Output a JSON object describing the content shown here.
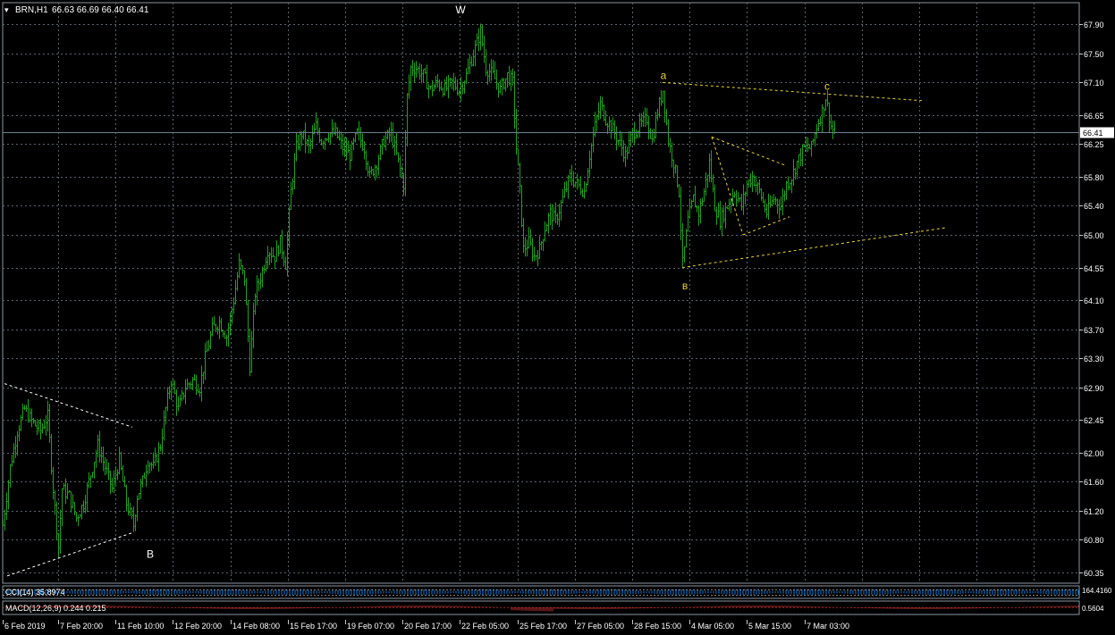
{
  "header": {
    "symbol_text": "BRN,H1",
    "ohlc_text": "66.63 66.69 66.40 66.41"
  },
  "colors": {
    "background": "#000000",
    "grid": "#5a6470",
    "candles": "#22a022",
    "wave_labels_primary": "#ffffff",
    "wave_labels_secondary": "#e6d33a",
    "triangle_lines": "#ffffff",
    "channel_lines": "#e6d33a",
    "current_price_line": "#6f7f8f",
    "indicator_cci": "#1e90ff",
    "indicator_macd": "#ff4040",
    "indicator_signal": "#ff4040"
  },
  "chart_data": {
    "type": "candlestick",
    "title": "BRN,H1",
    "current_price": 66.41,
    "current_price_label": "66.41",
    "ylim": [
      60.2,
      68.2
    ],
    "y_ticks": [
      "67.90",
      "67.50",
      "67.10",
      "66.65",
      "66.25",
      "65.80",
      "65.40",
      "65.00",
      "64.55",
      "64.10",
      "63.70",
      "63.30",
      "62.90",
      "62.45",
      "62.00",
      "61.60",
      "61.20",
      "60.80",
      "60.35"
    ],
    "x_ticks": [
      "6 Feb 2019",
      "7 Feb 20:00",
      "11 Feb 10:00",
      "12 Feb 20:00",
      "14 Feb 08:00",
      "15 Feb 17:00",
      "19 Feb 07:00",
      "20 Feb 17:00",
      "22 Feb 05:00",
      "25 Feb 17:00",
      "27 Feb 05:00",
      "28 Feb 15:00",
      "4 Mar 05:00",
      "5 Mar 15:00",
      "7 Mar 03:00"
    ],
    "price_path": [
      [
        0,
        61.0
      ],
      [
        8,
        61.8
      ],
      [
        16,
        62.3
      ],
      [
        24,
        62.6
      ],
      [
        34,
        62.4
      ],
      [
        42,
        62.3
      ],
      [
        50,
        62.5
      ],
      [
        56,
        61.5
      ],
      [
        62,
        60.7
      ],
      [
        66,
        61.5
      ],
      [
        74,
        61.4
      ],
      [
        82,
        61.1
      ],
      [
        90,
        61.3
      ],
      [
        98,
        61.7
      ],
      [
        106,
        62.1
      ],
      [
        114,
        61.8
      ],
      [
        122,
        61.5
      ],
      [
        130,
        61.9
      ],
      [
        138,
        61.3
      ],
      [
        146,
        61.0
      ],
      [
        150,
        61.4
      ],
      [
        156,
        61.6
      ],
      [
        162,
        61.9
      ],
      [
        168,
        61.8
      ],
      [
        176,
        62.1
      ],
      [
        182,
        62.6
      ],
      [
        188,
        63.0
      ],
      [
        196,
        62.6
      ],
      [
        204,
        62.9
      ],
      [
        212,
        63.0
      ],
      [
        220,
        62.9
      ],
      [
        226,
        63.3
      ],
      [
        234,
        63.7
      ],
      [
        242,
        63.8
      ],
      [
        250,
        63.6
      ],
      [
        258,
        64.1
      ],
      [
        264,
        64.6
      ],
      [
        270,
        64.4
      ],
      [
        276,
        63.2
      ],
      [
        282,
        64.2
      ],
      [
        290,
        64.5
      ],
      [
        296,
        64.8
      ],
      [
        304,
        64.7
      ],
      [
        310,
        64.9
      ],
      [
        316,
        64.6
      ],
      [
        322,
        65.6
      ],
      [
        328,
        66.2
      ],
      [
        334,
        66.4
      ],
      [
        342,
        66.2
      ],
      [
        350,
        66.5
      ],
      [
        356,
        66.3
      ],
      [
        364,
        66.4
      ],
      [
        372,
        66.4
      ],
      [
        380,
        66.2
      ],
      [
        388,
        66.1
      ],
      [
        396,
        66.4
      ],
      [
        404,
        66.2
      ],
      [
        410,
        65.8
      ],
      [
        418,
        66.0
      ],
      [
        426,
        66.3
      ],
      [
        434,
        66.4
      ],
      [
        440,
        66.1
      ],
      [
        448,
        65.7
      ],
      [
        452,
        66.9
      ],
      [
        456,
        67.3
      ],
      [
        462,
        67.3
      ],
      [
        470,
        67.2
      ],
      [
        478,
        67.0
      ],
      [
        486,
        67.1
      ],
      [
        494,
        67.0
      ],
      [
        502,
        67.1
      ],
      [
        510,
        67.0
      ],
      [
        518,
        67.2
      ],
      [
        526,
        67.5
      ],
      [
        534,
        67.8
      ],
      [
        540,
        67.3
      ],
      [
        548,
        67.2
      ],
      [
        556,
        67.0
      ],
      [
        564,
        67.2
      ],
      [
        570,
        67.1
      ],
      [
        574,
        66.2
      ],
      [
        578,
        65.6
      ],
      [
        582,
        64.8
      ],
      [
        588,
        64.9
      ],
      [
        594,
        64.7
      ],
      [
        600,
        64.8
      ],
      [
        606,
        65.1
      ],
      [
        612,
        65.3
      ],
      [
        618,
        65.2
      ],
      [
        626,
        65.5
      ],
      [
        634,
        65.8
      ],
      [
        642,
        65.7
      ],
      [
        650,
        65.6
      ],
      [
        656,
        66.1
      ],
      [
        662,
        66.5
      ],
      [
        668,
        66.8
      ],
      [
        674,
        66.6
      ],
      [
        680,
        66.5
      ],
      [
        688,
        66.3
      ],
      [
        696,
        66.1
      ],
      [
        704,
        66.4
      ],
      [
        712,
        66.5
      ],
      [
        720,
        66.6
      ],
      [
        726,
        66.3
      ],
      [
        732,
        66.7
      ],
      [
        738,
        67.0
      ],
      [
        744,
        66.3
      ],
      [
        750,
        66.0
      ],
      [
        756,
        65.6
      ],
      [
        760,
        64.6
      ],
      [
        766,
        65.2
      ],
      [
        772,
        65.5
      ],
      [
        778,
        65.3
      ],
      [
        784,
        65.6
      ],
      [
        790,
        66.0
      ],
      [
        796,
        65.4
      ],
      [
        802,
        65.2
      ],
      [
        810,
        65.4
      ],
      [
        818,
        65.6
      ],
      [
        826,
        65.4
      ],
      [
        832,
        65.7
      ],
      [
        838,
        65.8
      ],
      [
        846,
        65.6
      ],
      [
        854,
        65.3
      ],
      [
        862,
        65.5
      ],
      [
        870,
        65.4
      ],
      [
        876,
        65.7
      ],
      [
        882,
        65.8
      ],
      [
        888,
        66.0
      ],
      [
        896,
        66.2
      ],
      [
        904,
        66.2
      ],
      [
        910,
        66.5
      ],
      [
        916,
        66.7
      ],
      [
        920,
        66.9
      ],
      [
        926,
        66.5
      ],
      [
        930,
        66.41
      ]
    ],
    "annotations": [
      {
        "text": "W",
        "bar": 512,
        "price": 68.2,
        "color": "primary"
      },
      {
        "text": "a",
        "bar": 739,
        "price": 67.2,
        "color": "secondary"
      },
      {
        "text": "c",
        "bar": 922,
        "price": 67.05,
        "color": "secondary"
      },
      {
        "text": "в",
        "bar": 763,
        "price": 64.3,
        "color": "secondary"
      },
      {
        "text": "B",
        "bar": 165,
        "price": 60.6,
        "color": "primary"
      }
    ],
    "trend_lines": [
      {
        "name": "triangle-upper",
        "style": "dashed",
        "color": "triangle",
        "from": [
          2,
          62.95
        ],
        "to": [
          145,
          62.35
        ]
      },
      {
        "name": "triangle-lower",
        "style": "dashed",
        "color": "triangle",
        "from": [
          5,
          60.3
        ],
        "to": [
          146,
          60.9
        ]
      },
      {
        "name": "channel-upper",
        "style": "dashed",
        "color": "channel",
        "from": [
          738,
          67.1
        ],
        "to": [
          1028,
          66.85
        ]
      },
      {
        "name": "channel-lower",
        "style": "dashed",
        "color": "channel",
        "from": [
          760,
          64.55
        ],
        "to": [
          1055,
          65.1
        ]
      },
      {
        "name": "small-triangle-upper",
        "style": "dashed",
        "color": "channel",
        "from": [
          793,
          66.35
        ],
        "to": [
          877,
          65.95
        ]
      },
      {
        "name": "small-triangle-lower",
        "style": "dashed",
        "color": "channel",
        "from": [
          828,
          65.0
        ],
        "to": [
          880,
          65.25
        ]
      },
      {
        "name": "small-triangle-left",
        "style": "dashed",
        "color": "channel",
        "from": [
          793,
          66.35
        ],
        "to": [
          828,
          65.0
        ]
      }
    ],
    "indicators": {
      "cci": {
        "label": "CCI(14) 35.8974",
        "axis_label": "164.4160"
      },
      "macd": {
        "label": "MACD(12,26,9) 0.244 0.215",
        "axis_label": "0.5604"
      }
    }
  }
}
